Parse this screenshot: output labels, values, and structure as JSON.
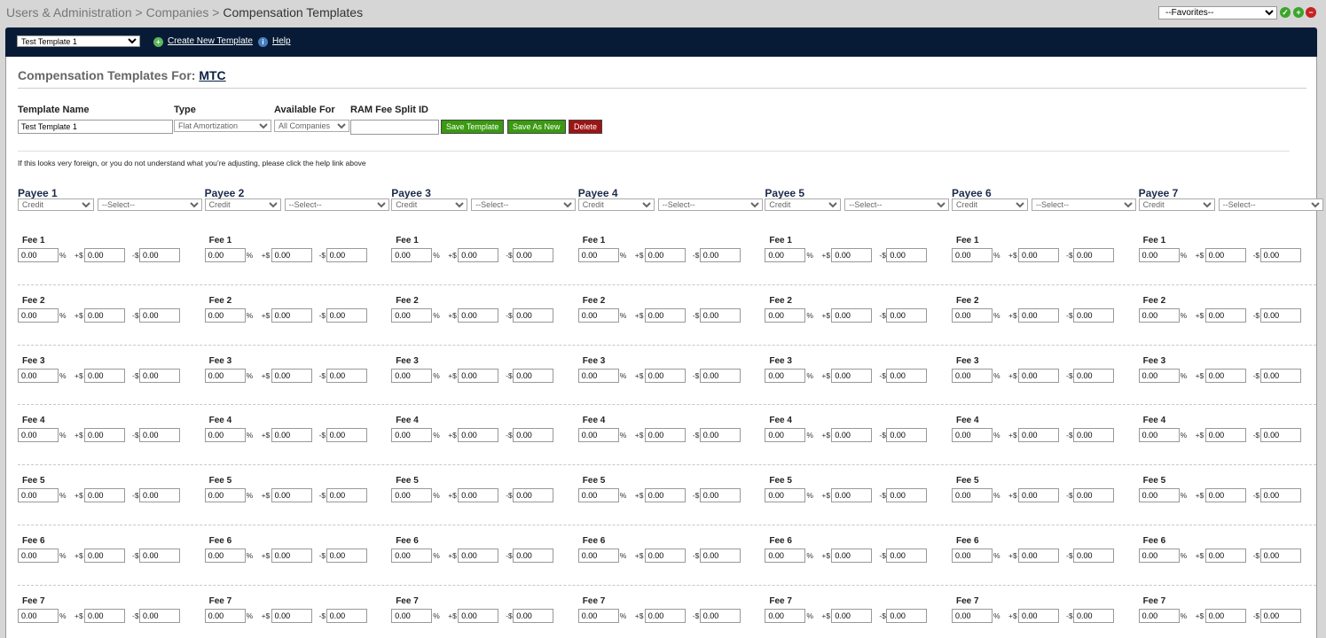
{
  "breadcrumb": {
    "part1": "Users & Administration",
    "sep": " > ",
    "part2": "Companies",
    "current": "Compensation Templates"
  },
  "favorites": {
    "selected": "--Favorites--"
  },
  "toolbar_icons": [
    {
      "name": "check-icon",
      "color": "#3aa52a",
      "glyph": "✓"
    },
    {
      "name": "add-icon",
      "color": "#3aa52a",
      "glyph": "+"
    },
    {
      "name": "remove-icon",
      "color": "#c62222",
      "glyph": "−"
    }
  ],
  "nav": {
    "template_select": "Test Template 1",
    "create_label": "Create New Template",
    "help_label": "Help",
    "create_icon_color": "#5cb85c",
    "help_icon_color": "#4a7fc1"
  },
  "heading": {
    "prefix": "Compensation Templates For:",
    "company": "MTC"
  },
  "form": {
    "template_name_label": "Template Name",
    "template_name_value": "Test Template 1",
    "type_label": "Type",
    "type_value": "Flat Amortization",
    "available_label": "Available For",
    "available_value": "All Companies",
    "ram_label": "RAM Fee Split ID",
    "ram_value": "",
    "save_label": "Save Template",
    "save_new_label": "Save As New",
    "delete_label": "Delete"
  },
  "notice": "If this looks very foreign, or you do not understand what you’re adjusting, please click the help link above",
  "payees": [
    {
      "name": "Payee 1",
      "type": "Credit",
      "select": "--Select--"
    },
    {
      "name": "Payee 2",
      "type": "Credit",
      "select": "--Select--"
    },
    {
      "name": "Payee 3",
      "type": "Credit",
      "select": "--Select--"
    },
    {
      "name": "Payee 4",
      "type": "Credit",
      "select": "--Select--"
    },
    {
      "name": "Payee 5",
      "type": "Credit",
      "select": "--Select--"
    },
    {
      "name": "Payee 6",
      "type": "Credit",
      "select": "--Select--"
    },
    {
      "name": "Payee 7",
      "type": "Credit",
      "select": "--Select--"
    }
  ],
  "fee_symbols": {
    "percent": "%",
    "plus": "+$",
    "minus": "-$"
  },
  "fees": [
    {
      "label": "Fee 1",
      "percent": "0.00",
      "plus": "0.00",
      "minus": "0.00"
    },
    {
      "label": "Fee 2",
      "percent": "0.00",
      "plus": "0.00",
      "minus": "0.00"
    },
    {
      "label": "Fee 3",
      "percent": "0.00",
      "plus": "0.00",
      "minus": "0.00"
    },
    {
      "label": "Fee 4",
      "percent": "0.00",
      "plus": "0.00",
      "minus": "0.00"
    },
    {
      "label": "Fee 5",
      "percent": "0.00",
      "plus": "0.00",
      "minus": "0.00"
    },
    {
      "label": "Fee 6",
      "percent": "0.00",
      "plus": "0.00",
      "minus": "0.00"
    },
    {
      "label": "Fee 7",
      "percent": "0.00",
      "plus": "0.00",
      "minus": "0.00"
    }
  ]
}
